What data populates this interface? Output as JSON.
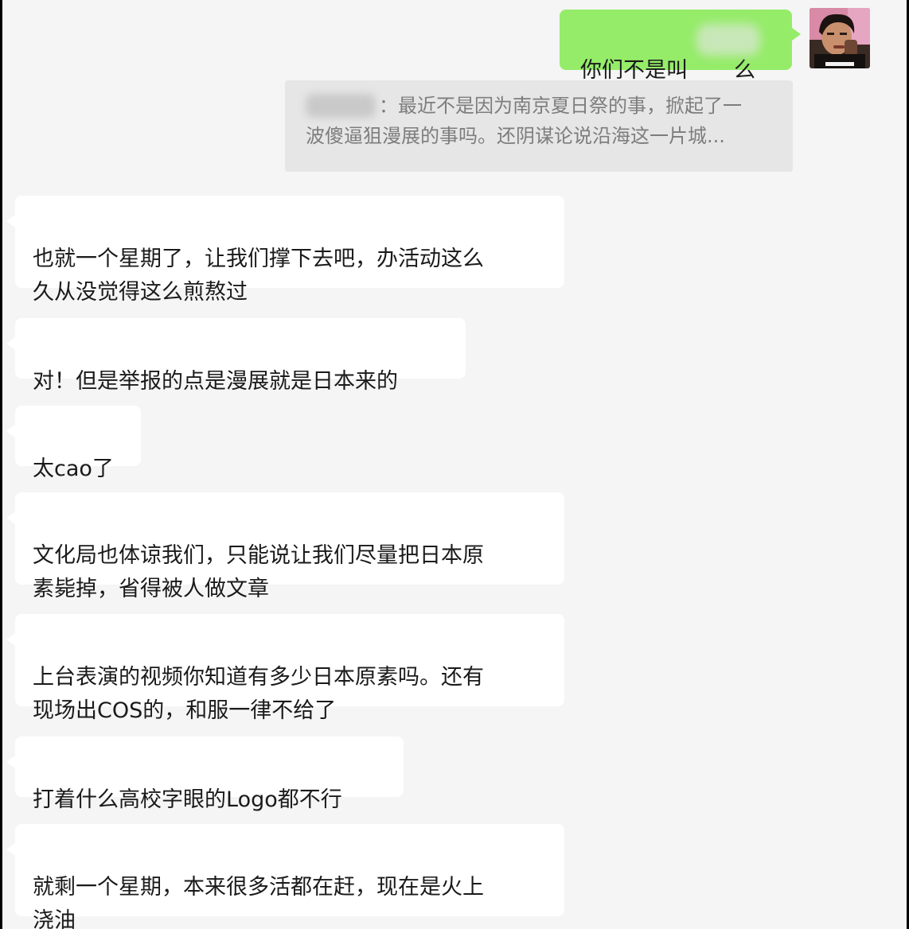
{
  "conversation": {
    "outgoing": {
      "text": "你们不是叫",
      "text_tail": "么"
    },
    "quote": {
      "text_part": "：最近不是因为南京夏日祭的事，掀起了一",
      "text_line2": "波傻逼狙漫展的事吗。还阴谋论说沿海这一片城..."
    },
    "messages": [
      {
        "text": "也就一个星期了，让我们撑下去吧，办活动这么\n久从没觉得这么煎熬过"
      },
      {
        "text": "对！但是举报的点是漫展就是日本来的"
      },
      {
        "text": "太cao了"
      },
      {
        "text": "文化局也体谅我们，只能说让我们尽量把日本原\n素毙掉，省得被人做文章"
      },
      {
        "text": "上台表演的视频你知道有多少日本原素吗。还有\n现场出COS的，和服一律不给了"
      },
      {
        "text": "打着什么高校字眼的Logo都不行"
      },
      {
        "text": "就剩一个星期，本来很多活都在赶，现在是火上\n浇油"
      }
    ]
  },
  "colors": {
    "chat_background": "#f5f5f5",
    "incoming_bubble": "#ffffff",
    "outgoing_bubble": "#95ec69",
    "quote_background": "#e6e6e6",
    "quote_text": "#7d7d7d"
  }
}
